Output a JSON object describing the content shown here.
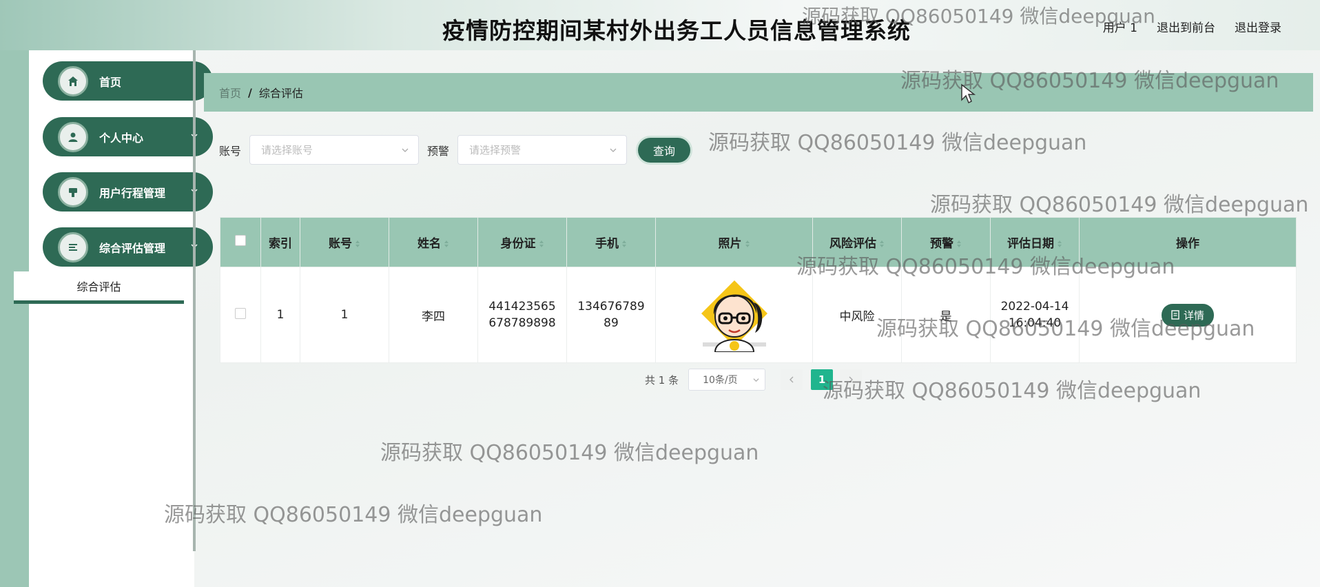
{
  "header": {
    "title": "疫情防控期间某村外出务工人员信息管理系统",
    "links": [
      "用户 1",
      "退出到前台",
      "退出登录"
    ]
  },
  "sidebar": {
    "items": [
      {
        "label": "首页",
        "icon": "home-icon"
      },
      {
        "label": "个人中心",
        "icon": "user-icon"
      },
      {
        "label": "用户行程管理",
        "icon": "itinerary-icon"
      },
      {
        "label": "综合评估管理",
        "icon": "list-icon"
      }
    ],
    "submenu_label": "综合评估"
  },
  "breadcrumb": {
    "home": "首页",
    "separator": "/",
    "current": "综合评估"
  },
  "search": {
    "account_label": "账号",
    "account_placeholder": "请选择账号",
    "warning_label": "预警",
    "warning_placeholder": "请选择预警",
    "query_button": "查询"
  },
  "table": {
    "columns": [
      "索引",
      "账号",
      "姓名",
      "身份证",
      "手机",
      "照片",
      "风险评估",
      "预警",
      "评估日期",
      "操作"
    ],
    "rows": [
      {
        "index": "1",
        "account": "1",
        "name": "李四",
        "id_card": "441423565678789898",
        "phone": "13467678989",
        "risk": "中风险",
        "warning": "是",
        "date": "2022-04-14 16:04:40",
        "action": "详情"
      }
    ]
  },
  "pagination": {
    "total": "共 1 条",
    "page_size": "10条/页",
    "current_page": "1"
  },
  "watermark": "源码获取 QQ86050149 微信deepguan",
  "colors": {
    "primary": "#2e6a55",
    "header_green": "#99c6b3",
    "active_page": "#20b58e"
  }
}
